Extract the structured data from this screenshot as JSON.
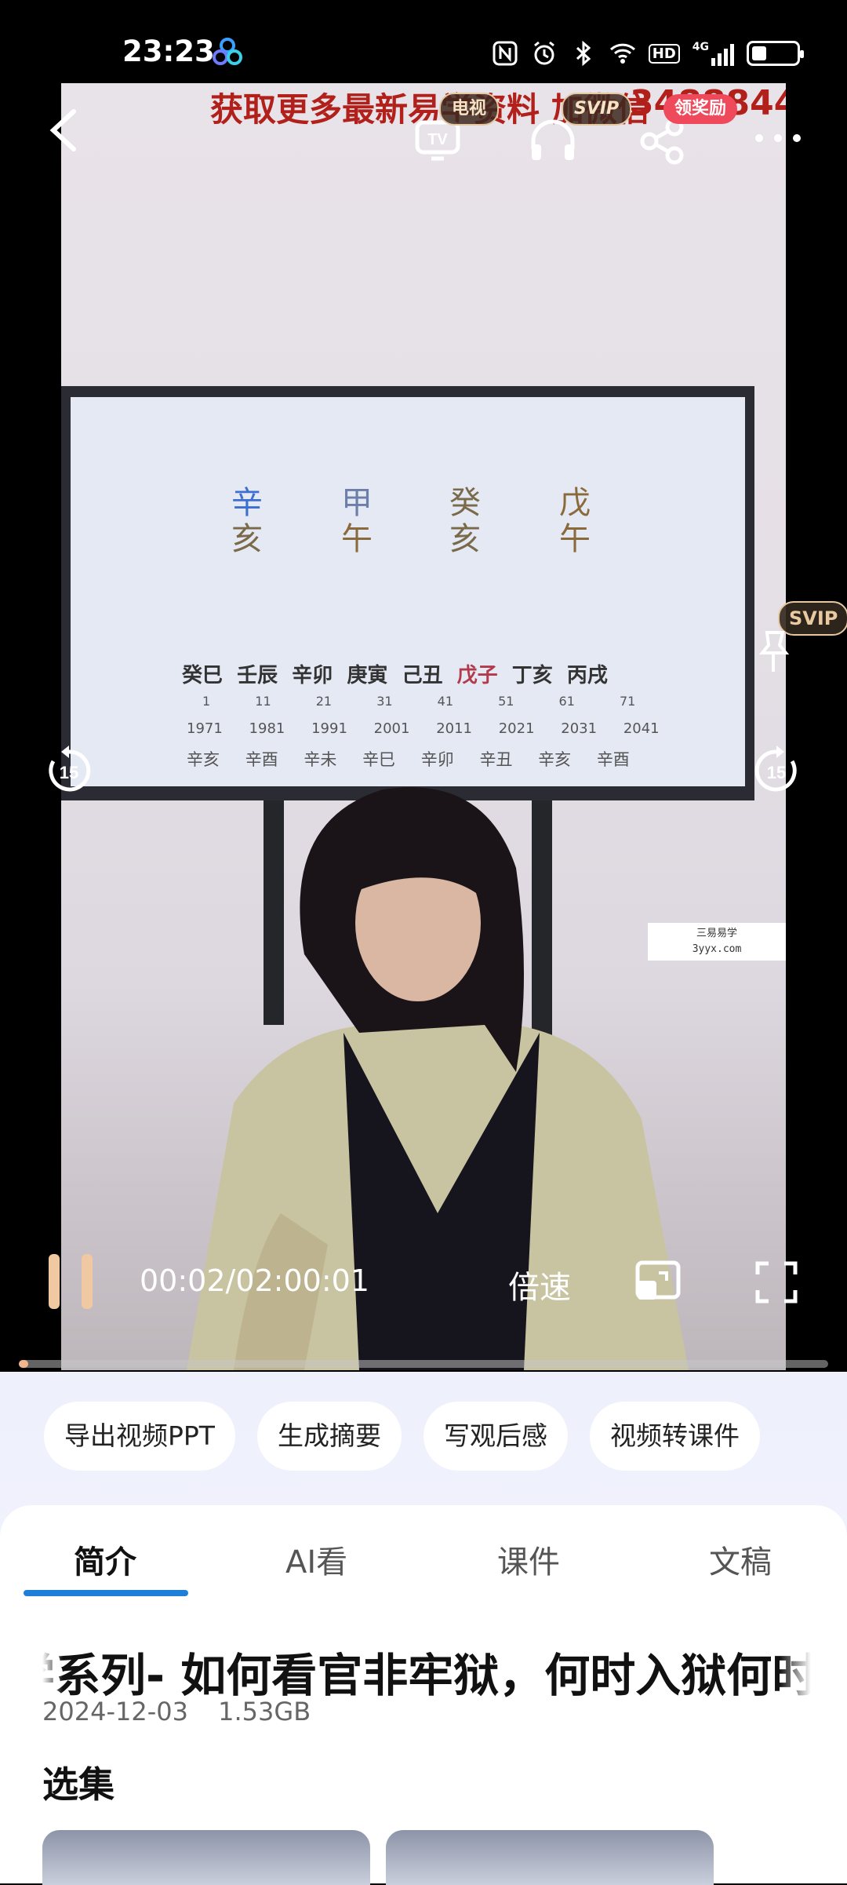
{
  "status": {
    "time": "23:23",
    "network": "4G",
    "hd": "HD"
  },
  "video": {
    "banner_text": "获取更多最新易学资料 加微信",
    "banner_number": "34888440",
    "timecode": "00:02/02:00:01",
    "speed_label": "倍速",
    "rewind_label": "15",
    "forward_label": "15",
    "progress": 0.01,
    "watermark": {
      "line1": "三易易学",
      "line2": "3yyx.com"
    }
  },
  "top": {
    "badge_tv": "电视",
    "badge_svip": "SVIP",
    "badge_reward": "领奖励",
    "side_svip": "SVIP"
  },
  "chips": [
    "导出视频PPT",
    "生成摘要",
    "写观后感",
    "视频转课件"
  ],
  "tabs": [
    "简介",
    "AI看",
    "课件",
    "文稿"
  ],
  "detail": {
    "title": "易学系列- 如何看官非牢狱，何时入狱何时出狱",
    "date": "2024-12-03",
    "size": "1.53GB",
    "episodes_label": "选集"
  },
  "tv_screen": {
    "big_chars": [
      "辛",
      "甲",
      "癸",
      "戊",
      "亥",
      "午",
      "亥",
      "午"
    ],
    "dayun": [
      "癸巳",
      "壬辰",
      "辛卯",
      "庚寅",
      "己丑",
      "戊子",
      "丁亥",
      "丙戌"
    ],
    "ages": [
      "1",
      "11",
      "21",
      "31",
      "41",
      "51",
      "61",
      "71"
    ],
    "years": [
      "1971",
      "1981",
      "1991",
      "2001",
      "2011",
      "2021",
      "2031",
      "2041"
    ],
    "liunian": [
      "辛亥",
      "辛酉",
      "辛未",
      "辛巳",
      "辛卯",
      "辛丑",
      "辛亥",
      "辛酉"
    ]
  },
  "colors": {
    "accent": "#1e7fd8",
    "reward": "#ef4a5c",
    "banner": "#b1201a",
    "pause": "#f0c9a2"
  }
}
